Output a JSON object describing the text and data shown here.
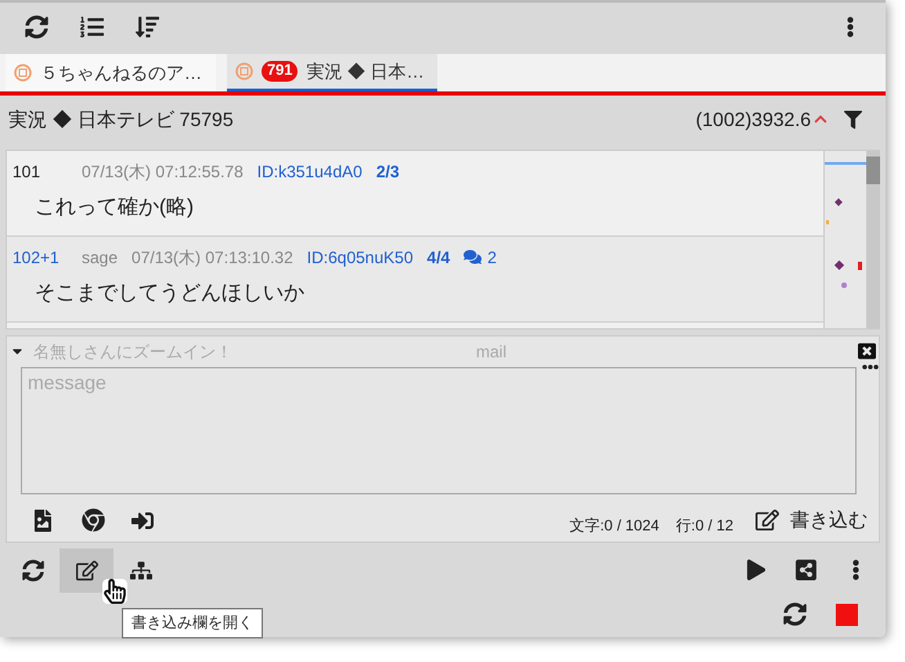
{
  "tabs": [
    {
      "label": "５ちゃんねるのア…",
      "selected": false
    },
    {
      "label": "実況 ◆ 日本…",
      "badge": "791",
      "selected": true
    }
  ],
  "thread_header": {
    "title": "実況 ◆ 日本テレビ 75795",
    "stats": "(1002)3932.6"
  },
  "posts": [
    {
      "number": "101",
      "linked": false,
      "date": "07/13(木) 07:12:55.78",
      "id": "ID:k351u4dA0",
      "count": "2/3",
      "body": "これって確か(略)"
    },
    {
      "number": "102+1",
      "linked": true,
      "mail": "sage",
      "date": "07/13(木) 07:13:10.32",
      "id": "ID:6q05nuK50",
      "count": "4/4",
      "replies": "2",
      "body": "そこまでしてうどんほしいか"
    }
  ],
  "compose": {
    "name_placeholder": "名無しさんにズームイン！",
    "mail_placeholder": "mail",
    "message_placeholder": "message",
    "char_count": "文字:0 / 1024",
    "line_count": "行:0 / 12",
    "submit": "書き込む"
  },
  "bottom_toolbar": {
    "left_buttons": [
      {
        "kind": "refresh",
        "hovered": false
      },
      {
        "kind": "edit",
        "hovered": true
      },
      {
        "kind": "tree",
        "hovered": false
      }
    ]
  },
  "tooltip": "書き込み欄を開く"
}
